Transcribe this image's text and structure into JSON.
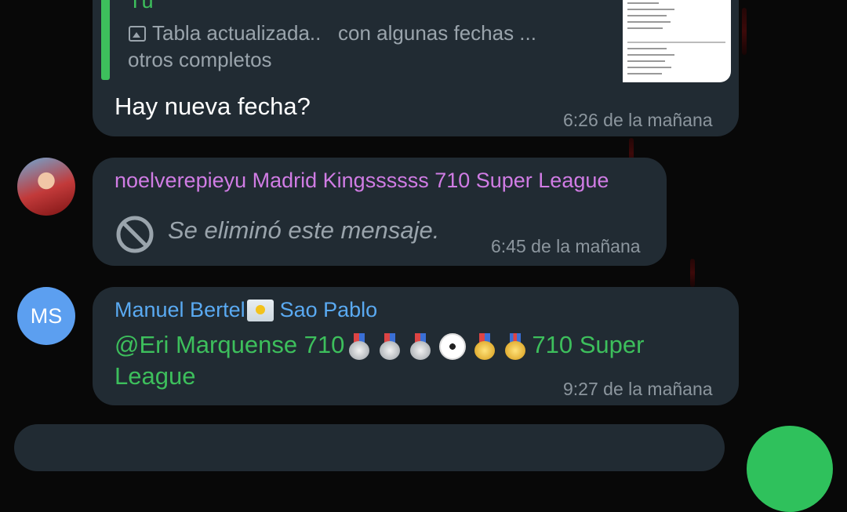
{
  "reply_quote": {
    "author": "Tú",
    "line1": "Tabla actualizada..   con algunas fechas ...",
    "line2": "otros completos",
    "icon": "photo-icon"
  },
  "messages": [
    {
      "text": "Hay nueva fecha?",
      "time": "6:26 de la mañana"
    },
    {
      "sender": "noelverepieyu Madrid Kingssssss 710 Super League",
      "text": "Se eliminó este mensaje.",
      "time": "6:45 de la mañana",
      "icon": "ban-icon"
    },
    {
      "sender_part1": "Manuel Bertel",
      "sender_part2": "Sao Pablo",
      "text_prefix": "@Eri Marquense 710",
      "text_suffix": "710 Super League",
      "emojis": [
        "silver-medal",
        "silver-medal",
        "silver-medal",
        "soccer-ball",
        "gold-medal",
        "military-medal"
      ],
      "time": "9:27 de la mañana"
    }
  ],
  "avatars": {
    "second_initials": "MS"
  },
  "colors": {
    "background": "#080808",
    "bubble": "#212b33",
    "green": "#3dbf5c",
    "pink_sender": "#d07ce4",
    "blue_sender": "#5aaaf2",
    "avatar_ms": "#5c9ff0"
  }
}
